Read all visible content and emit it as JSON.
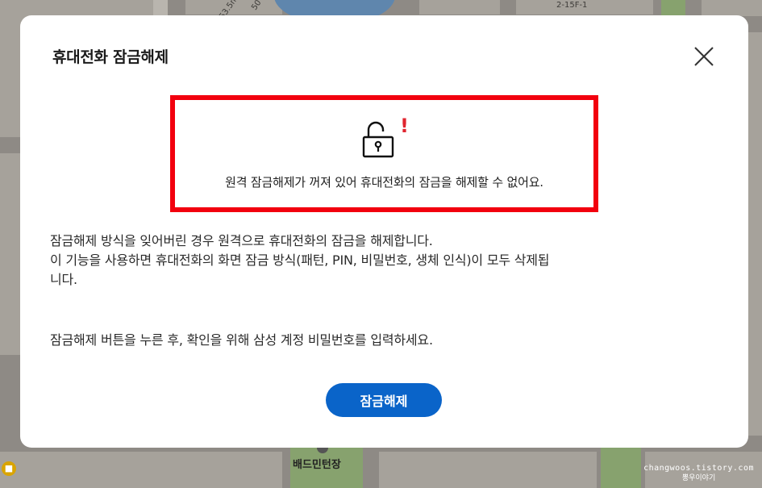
{
  "map": {
    "road_labels": [
      "53.5m",
      "50",
      "2-15F-1"
    ],
    "poi_label": "배드민턴장",
    "watermark_url": "changwoos.tistory.com",
    "watermark_name": "뽕우이야기"
  },
  "dialog": {
    "title": "휴대전화 잠금해제",
    "warning": {
      "icon": "unlock-icon",
      "alert_mark": "!",
      "text": "원격 잠금해제가 꺼져 있어 휴대전화의 잠금을 해제할 수 없어요."
    },
    "description": [
      "잠금해제 방식을 잊어버린 경우 원격으로 휴대전화의 잠금을 해제합니다.",
      "이 기능을 사용하면 휴대전화의 화면 잠금 방식(패턴, PIN, 비밀번호, 생체 인식)이 모두 삭제됩",
      "니다."
    ],
    "instruction": "잠금해제 버튼을 누른 후, 확인을 위해 삼성 계정 비밀번호를 입력하세요.",
    "primary_button_label": "잠금해제"
  },
  "colors": {
    "highlight_border": "#f2000e",
    "alert_mark": "#e0252f",
    "primary_button": "#0a64c9"
  }
}
